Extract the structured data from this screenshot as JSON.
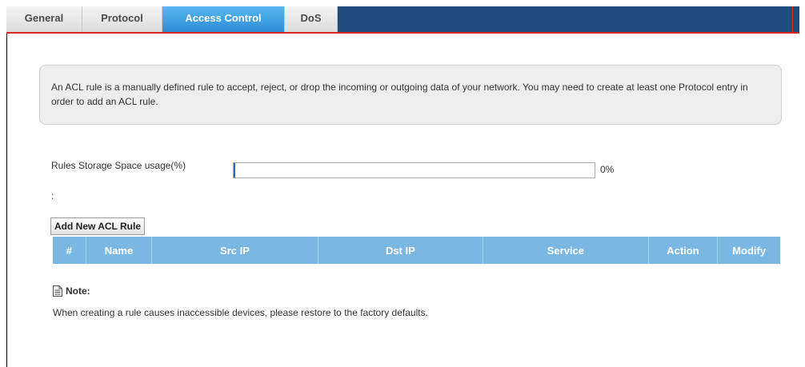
{
  "tabs": [
    {
      "label": "General"
    },
    {
      "label": "Protocol"
    },
    {
      "label": "Access Control",
      "active": true
    },
    {
      "label": "DoS"
    }
  ],
  "info": {
    "text": "An ACL rule is a manually defined rule to accept, reject, or drop the incoming or outgoing data of your network. You may need to create at least one Protocol entry in order to add an ACL rule."
  },
  "storage": {
    "label_line1": "Rules Storage Space usage(%)",
    "label_line2": ":",
    "value_text": "0%",
    "fraction": 0
  },
  "add_button": {
    "label": "Add New ACL Rule"
  },
  "table": {
    "columns": [
      "#",
      "Name",
      "Src IP",
      "Dst IP",
      "Service",
      "Action",
      "Modify"
    ],
    "rows": []
  },
  "note": {
    "title": "Note:",
    "text": "When creating a rule causes inaccessible devices, please restore to the factory defaults."
  },
  "colors": {
    "tab_bar": "#1f4a80",
    "active_tab": "#2d8dd6",
    "table_header": "#7ab7e3",
    "accent_red": "#d7281e"
  }
}
